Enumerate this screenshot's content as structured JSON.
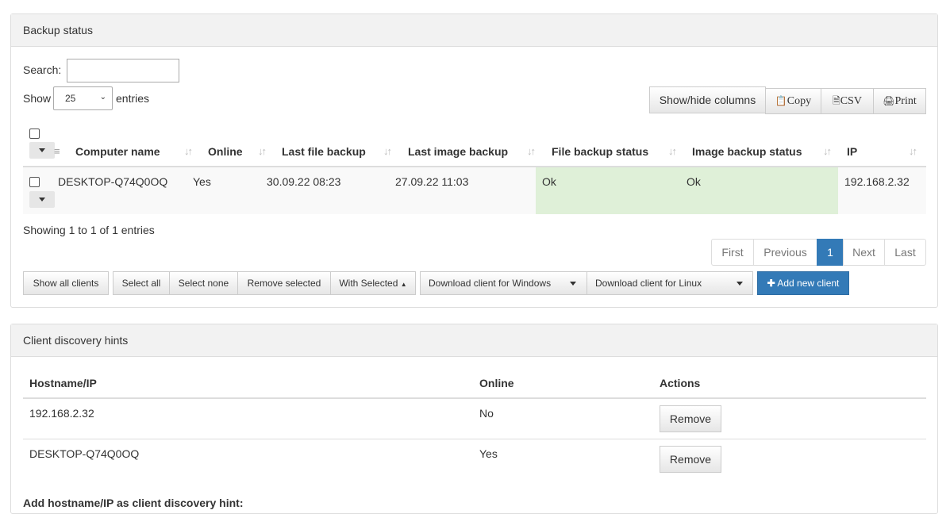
{
  "backup": {
    "title": "Backup status",
    "search_label": "Search:",
    "search_value": "",
    "show_label": "Show",
    "entries_label": "entries",
    "page_size": "25",
    "buttons": {
      "show_hide": "Show/hide columns",
      "copy": "Copy",
      "csv": "CSV",
      "print": "Print"
    },
    "columns": [
      "Computer name",
      "Online",
      "Last file backup",
      "Last image backup",
      "File backup status",
      "Image backup status",
      "IP"
    ],
    "rows": [
      {
        "name": "DESKTOP-Q74Q0OQ",
        "online": "Yes",
        "last_file": "30.09.22 08:23",
        "last_image": "27.09.22 11:03",
        "file_status": "Ok",
        "image_status": "Ok",
        "ip": "192.168.2.32"
      }
    ],
    "info": "Showing 1 to 1 of 1 entries",
    "pagination": {
      "first": "First",
      "previous": "Previous",
      "current": "1",
      "next": "Next",
      "last": "Last"
    },
    "actions": {
      "show_all": "Show all clients",
      "select_all": "Select all",
      "select_none": "Select none",
      "remove_selected": "Remove selected",
      "with_selected": "With Selected",
      "download_windows": "Download client for Windows",
      "download_linux": "Download client for Linux",
      "add_client": "Add new client"
    },
    "colors": {
      "status_ok": "#dff0d8",
      "primary": "#337ab7"
    }
  },
  "discovery": {
    "title": "Client discovery hints",
    "columns": [
      "Hostname/IP",
      "Online",
      "Actions"
    ],
    "rows": [
      {
        "host": "192.168.2.32",
        "online": "No",
        "action": "Remove"
      },
      {
        "host": "DESKTOP-Q74Q0OQ",
        "online": "Yes",
        "action": "Remove"
      }
    ],
    "add_label": "Add hostname/IP as client discovery hint:"
  }
}
